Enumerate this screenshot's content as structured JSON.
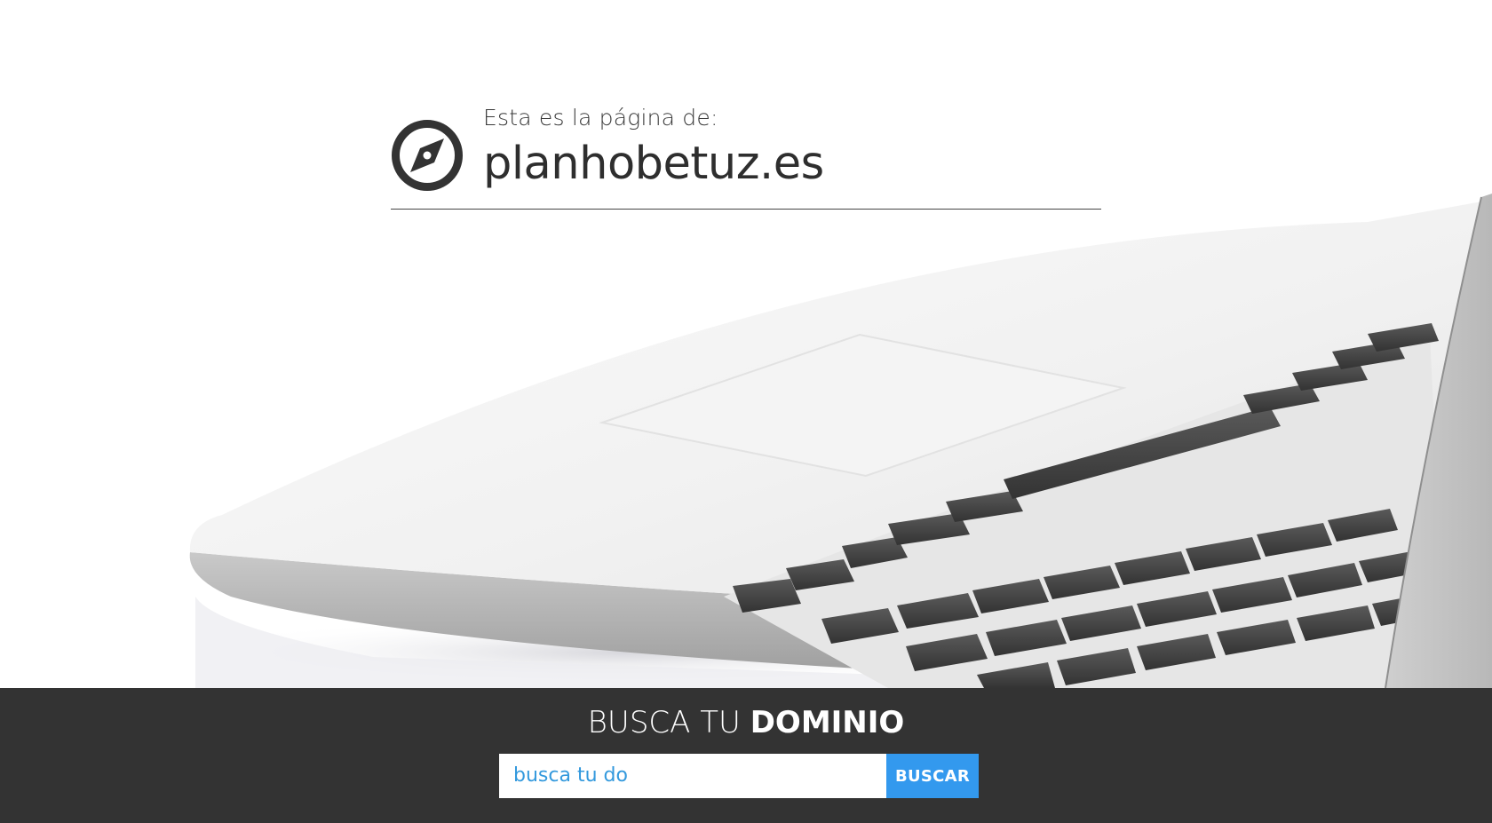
{
  "header": {
    "subtitle": "Esta es la página de:",
    "domain": "planhobetuz.es",
    "icon": "compass-icon"
  },
  "search": {
    "heading_light": "BUSCA TU",
    "heading_bold": "DOMINIO",
    "input_value": "busca tu do",
    "button_label": "BUSCAR"
  },
  "colors": {
    "band_background": "#333333",
    "button_background": "#3399ee",
    "input_text": "#3399dd",
    "title_text": "#2e2e2e"
  }
}
